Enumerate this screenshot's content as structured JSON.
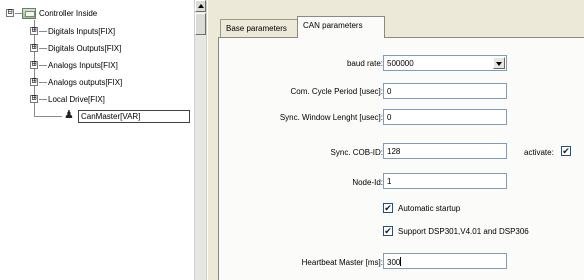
{
  "tree": {
    "root": {
      "label": "Controller Inside",
      "expander": "⊟",
      "icon": "controller-icon"
    },
    "items": [
      {
        "label": "Digitals Inputs[FIX]",
        "expander": "⊞"
      },
      {
        "label": "Digitals Outputs[FIX]",
        "expander": "⊞"
      },
      {
        "label": "Analogs Inputs[FIX]",
        "expander": "⊞"
      },
      {
        "label": "Analogs outputs[FIX]",
        "expander": "⊞"
      },
      {
        "label": "Local Drive[FIX]",
        "expander": "⊞"
      }
    ],
    "selected": {
      "label": "CanMaster[VAR]",
      "icon": "can-network-icon",
      "icon_glyph": "♟"
    }
  },
  "tabs": [
    {
      "label": "Base parameters",
      "active": false
    },
    {
      "label": "CAN parameters",
      "active": true
    }
  ],
  "form": {
    "baud_rate": {
      "label": "baud rate:",
      "value": "500000"
    },
    "cycle_period": {
      "label": "Com. Cycle Period [usec]:",
      "value": "0"
    },
    "sync_window": {
      "label": "Sync. Window Lenght [usec]:",
      "value": "0"
    },
    "sync_cob": {
      "label": "Sync. COB-ID:",
      "value": "128"
    },
    "activate": {
      "label": "activate:",
      "checked": true,
      "mark": "✔"
    },
    "node_id": {
      "label": "Node-Id:",
      "value": "1"
    },
    "auto_startup": {
      "label": "Automatic startup",
      "checked": true,
      "mark": "✔"
    },
    "support_dsp": {
      "label": "Support DSP301,V4.01 and DSP306",
      "checked": true,
      "mark": "✔"
    },
    "heartbeat": {
      "label": "Heartbeat Master [ms]:",
      "value": "300"
    }
  },
  "colors": {
    "panel_bg": "#ece9d8",
    "field_border": "#7f9db9",
    "tab_body_bg": "#fbfbf9"
  }
}
